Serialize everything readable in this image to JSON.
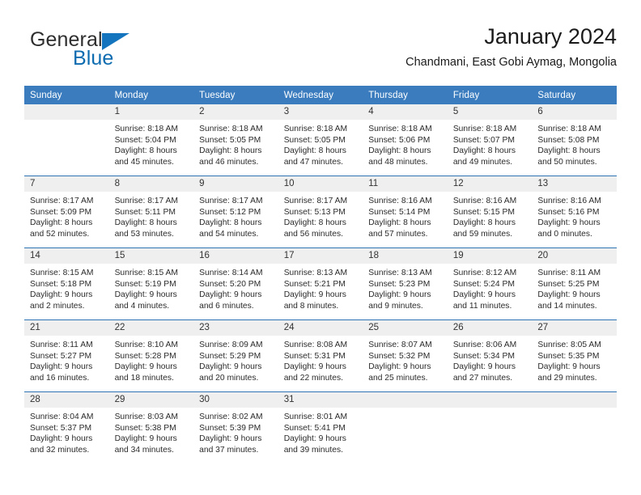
{
  "brand": {
    "word1": "General",
    "word2": "Blue",
    "flag_icon": "blue-triangle-flag-icon",
    "accent_color": "#0d6bb0"
  },
  "header": {
    "title": "January 2024",
    "subtitle": "Chandmani, East Gobi Aymag, Mongolia"
  },
  "theme": {
    "header_blue": "#3a7cbe",
    "separator_blue": "#2f74b5",
    "daynum_band": "#efefef"
  },
  "calendar": {
    "weekday_headers": [
      "Sunday",
      "Monday",
      "Tuesday",
      "Wednesday",
      "Thursday",
      "Friday",
      "Saturday"
    ],
    "weeks": [
      [
        {
          "day": "",
          "lines": []
        },
        {
          "day": "1",
          "lines": [
            "Sunrise: 8:18 AM",
            "Sunset: 5:04 PM",
            "Daylight: 8 hours",
            "and 45 minutes."
          ]
        },
        {
          "day": "2",
          "lines": [
            "Sunrise: 8:18 AM",
            "Sunset: 5:05 PM",
            "Daylight: 8 hours",
            "and 46 minutes."
          ]
        },
        {
          "day": "3",
          "lines": [
            "Sunrise: 8:18 AM",
            "Sunset: 5:05 PM",
            "Daylight: 8 hours",
            "and 47 minutes."
          ]
        },
        {
          "day": "4",
          "lines": [
            "Sunrise: 8:18 AM",
            "Sunset: 5:06 PM",
            "Daylight: 8 hours",
            "and 48 minutes."
          ]
        },
        {
          "day": "5",
          "lines": [
            "Sunrise: 8:18 AM",
            "Sunset: 5:07 PM",
            "Daylight: 8 hours",
            "and 49 minutes."
          ]
        },
        {
          "day": "6",
          "lines": [
            "Sunrise: 8:18 AM",
            "Sunset: 5:08 PM",
            "Daylight: 8 hours",
            "and 50 minutes."
          ]
        }
      ],
      [
        {
          "day": "7",
          "lines": [
            "Sunrise: 8:17 AM",
            "Sunset: 5:09 PM",
            "Daylight: 8 hours",
            "and 52 minutes."
          ]
        },
        {
          "day": "8",
          "lines": [
            "Sunrise: 8:17 AM",
            "Sunset: 5:11 PM",
            "Daylight: 8 hours",
            "and 53 minutes."
          ]
        },
        {
          "day": "9",
          "lines": [
            "Sunrise: 8:17 AM",
            "Sunset: 5:12 PM",
            "Daylight: 8 hours",
            "and 54 minutes."
          ]
        },
        {
          "day": "10",
          "lines": [
            "Sunrise: 8:17 AM",
            "Sunset: 5:13 PM",
            "Daylight: 8 hours",
            "and 56 minutes."
          ]
        },
        {
          "day": "11",
          "lines": [
            "Sunrise: 8:16 AM",
            "Sunset: 5:14 PM",
            "Daylight: 8 hours",
            "and 57 minutes."
          ]
        },
        {
          "day": "12",
          "lines": [
            "Sunrise: 8:16 AM",
            "Sunset: 5:15 PM",
            "Daylight: 8 hours",
            "and 59 minutes."
          ]
        },
        {
          "day": "13",
          "lines": [
            "Sunrise: 8:16 AM",
            "Sunset: 5:16 PM",
            "Daylight: 9 hours",
            "and 0 minutes."
          ]
        }
      ],
      [
        {
          "day": "14",
          "lines": [
            "Sunrise: 8:15 AM",
            "Sunset: 5:18 PM",
            "Daylight: 9 hours",
            "and 2 minutes."
          ]
        },
        {
          "day": "15",
          "lines": [
            "Sunrise: 8:15 AM",
            "Sunset: 5:19 PM",
            "Daylight: 9 hours",
            "and 4 minutes."
          ]
        },
        {
          "day": "16",
          "lines": [
            "Sunrise: 8:14 AM",
            "Sunset: 5:20 PM",
            "Daylight: 9 hours",
            "and 6 minutes."
          ]
        },
        {
          "day": "17",
          "lines": [
            "Sunrise: 8:13 AM",
            "Sunset: 5:21 PM",
            "Daylight: 9 hours",
            "and 8 minutes."
          ]
        },
        {
          "day": "18",
          "lines": [
            "Sunrise: 8:13 AM",
            "Sunset: 5:23 PM",
            "Daylight: 9 hours",
            "and 9 minutes."
          ]
        },
        {
          "day": "19",
          "lines": [
            "Sunrise: 8:12 AM",
            "Sunset: 5:24 PM",
            "Daylight: 9 hours",
            "and 11 minutes."
          ]
        },
        {
          "day": "20",
          "lines": [
            "Sunrise: 8:11 AM",
            "Sunset: 5:25 PM",
            "Daylight: 9 hours",
            "and 14 minutes."
          ]
        }
      ],
      [
        {
          "day": "21",
          "lines": [
            "Sunrise: 8:11 AM",
            "Sunset: 5:27 PM",
            "Daylight: 9 hours",
            "and 16 minutes."
          ]
        },
        {
          "day": "22",
          "lines": [
            "Sunrise: 8:10 AM",
            "Sunset: 5:28 PM",
            "Daylight: 9 hours",
            "and 18 minutes."
          ]
        },
        {
          "day": "23",
          "lines": [
            "Sunrise: 8:09 AM",
            "Sunset: 5:29 PM",
            "Daylight: 9 hours",
            "and 20 minutes."
          ]
        },
        {
          "day": "24",
          "lines": [
            "Sunrise: 8:08 AM",
            "Sunset: 5:31 PM",
            "Daylight: 9 hours",
            "and 22 minutes."
          ]
        },
        {
          "day": "25",
          "lines": [
            "Sunrise: 8:07 AM",
            "Sunset: 5:32 PM",
            "Daylight: 9 hours",
            "and 25 minutes."
          ]
        },
        {
          "day": "26",
          "lines": [
            "Sunrise: 8:06 AM",
            "Sunset: 5:34 PM",
            "Daylight: 9 hours",
            "and 27 minutes."
          ]
        },
        {
          "day": "27",
          "lines": [
            "Sunrise: 8:05 AM",
            "Sunset: 5:35 PM",
            "Daylight: 9 hours",
            "and 29 minutes."
          ]
        }
      ],
      [
        {
          "day": "28",
          "lines": [
            "Sunrise: 8:04 AM",
            "Sunset: 5:37 PM",
            "Daylight: 9 hours",
            "and 32 minutes."
          ]
        },
        {
          "day": "29",
          "lines": [
            "Sunrise: 8:03 AM",
            "Sunset: 5:38 PM",
            "Daylight: 9 hours",
            "and 34 minutes."
          ]
        },
        {
          "day": "30",
          "lines": [
            "Sunrise: 8:02 AM",
            "Sunset: 5:39 PM",
            "Daylight: 9 hours",
            "and 37 minutes."
          ]
        },
        {
          "day": "31",
          "lines": [
            "Sunrise: 8:01 AM",
            "Sunset: 5:41 PM",
            "Daylight: 9 hours",
            "and 39 minutes."
          ]
        },
        {
          "day": "",
          "lines": []
        },
        {
          "day": "",
          "lines": []
        },
        {
          "day": "",
          "lines": []
        }
      ]
    ]
  }
}
